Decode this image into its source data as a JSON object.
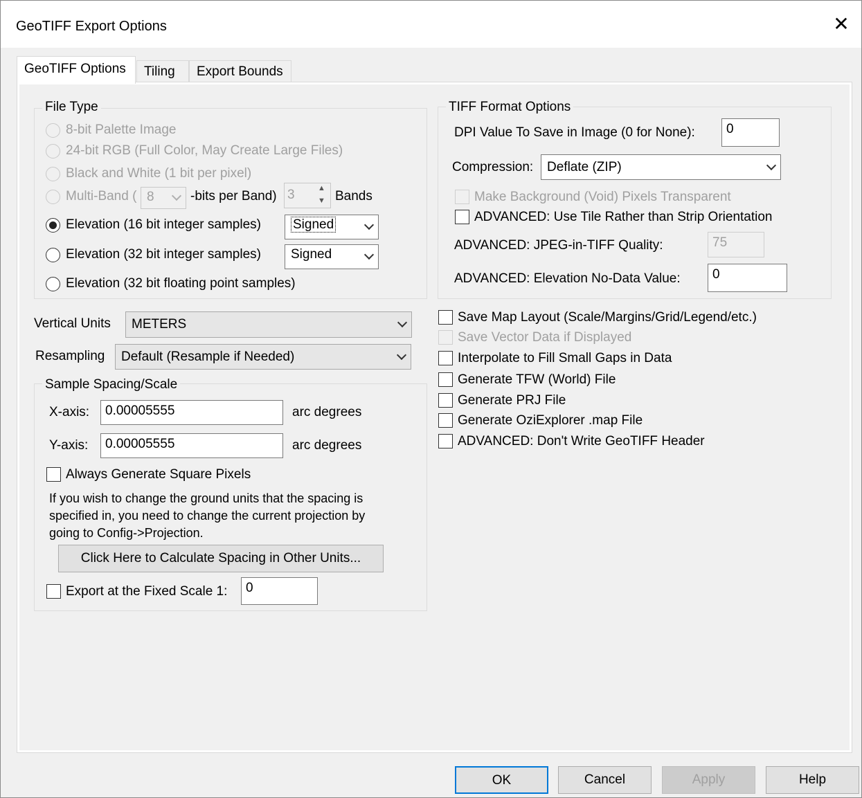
{
  "window": {
    "title": "GeoTIFF Export Options",
    "close_glyph": "✕"
  },
  "tabs": [
    {
      "label": "GeoTIFF Options",
      "active": true
    },
    {
      "label": "Tiling",
      "active": false
    },
    {
      "label": "Export Bounds",
      "active": false
    }
  ],
  "file_type": {
    "group_label": "File Type",
    "palette_label": "8-bit Palette Image",
    "rgb_label": "24-bit RGB (Full Color, May Create Large Files)",
    "bw_label": "Black and White (1 bit per pixel)",
    "multiband_prefix": "Multi-Band (",
    "multiband_bits_value": "8",
    "multiband_bits_suffix": "-bits per Band)",
    "multiband_bands_value": "3",
    "multiband_bands_label": "Bands",
    "elev16_label": "Elevation (16 bit integer samples)",
    "elev16_sign": "Signed",
    "elev32_label": "Elevation (32 bit integer samples)",
    "elev32_sign": "Signed",
    "elevfloat_label": "Elevation (32 bit floating point samples)",
    "selected": "elev16"
  },
  "vertical_units": {
    "label": "Vertical Units",
    "value": "METERS"
  },
  "resampling": {
    "label": "Resampling",
    "value": "Default (Resample if Needed)"
  },
  "sample_spacing": {
    "group_label": "Sample Spacing/Scale",
    "x_label": "X-axis:",
    "x_value": "0.00005555",
    "x_unit": "arc degrees",
    "y_label": "Y-axis:",
    "y_value": "0.00005555",
    "y_unit": "arc degrees",
    "square_pixels_label": "Always Generate Square Pixels",
    "square_pixels_checked": false,
    "info_line1": "If you wish to change the ground units that the spacing is",
    "info_line2": "specified in, you need to change the current projection by",
    "info_line3": "going to Config->Projection.",
    "calc_button": "Click Here to Calculate Spacing in Other Units...",
    "fixed_scale_label": "Export at the Fixed Scale 1:",
    "fixed_scale_checked": false,
    "fixed_scale_value": "0"
  },
  "tiff_format": {
    "group_label": "TIFF Format Options",
    "dpi_label": "DPI Value To Save in Image (0 for None):",
    "dpi_value": "0",
    "compression_label": "Compression:",
    "compression_value": "Deflate (ZIP)",
    "transparent_label": "Make Background (Void) Pixels Transparent",
    "tile_label": "ADVANCED: Use Tile Rather than Strip Orientation",
    "jpeg_label": "ADVANCED: JPEG-in-TIFF Quality:",
    "jpeg_value": "75",
    "nodata_label": "ADVANCED: Elevation No-Data Value:",
    "nodata_value": "0"
  },
  "options": {
    "map_layout": "Save Map Layout (Scale/Margins/Grid/Legend/etc.)",
    "vector_data": "Save Vector Data if Displayed",
    "interpolate": "Interpolate to Fill Small Gaps in Data",
    "tfw": "Generate TFW (World) File",
    "prj": "Generate PRJ File",
    "ozi": "Generate OziExplorer .map File",
    "no_header": "ADVANCED: Don't Write GeoTIFF Header"
  },
  "buttons": {
    "ok": "OK",
    "cancel": "Cancel",
    "apply": "Apply",
    "help": "Help"
  }
}
